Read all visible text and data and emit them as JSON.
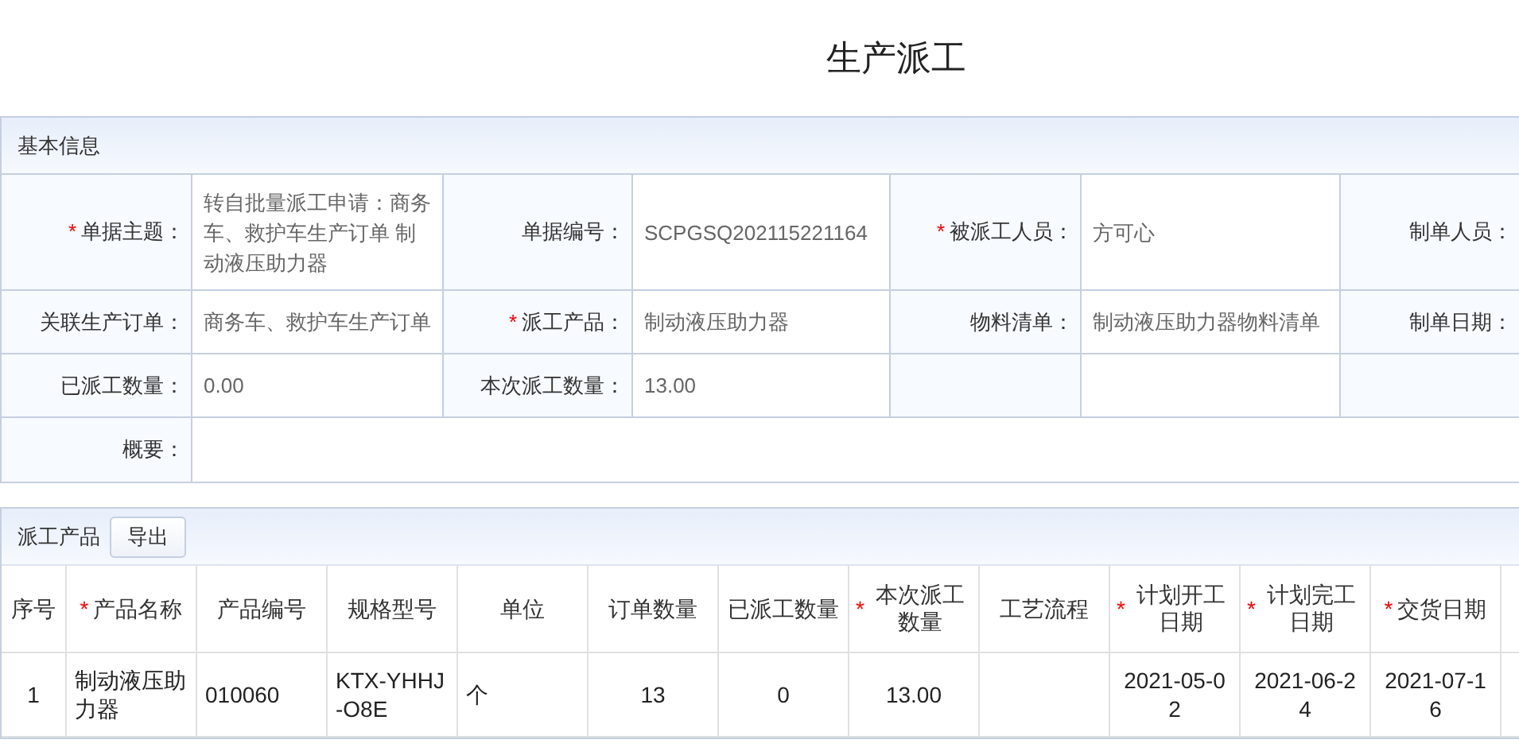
{
  "title": "生产派工",
  "basic_info": {
    "title": "基本信息",
    "rows": [
      [
        {
          "mark": "*",
          "label": "单据主题：",
          "value": "转自批量派工申请：商务车、救护车生产订单 制动液压助力器"
        },
        {
          "label": "单据编号：",
          "value": "SCPGSQ202115221164"
        },
        {
          "mark": "*",
          "label": "被派工人员：",
          "value": "方可心"
        },
        {
          "label": "制单人员："
        }
      ],
      [
        {
          "label": "关联生产订单：",
          "value": "商务车、救护车生产订单"
        },
        {
          "mark": "*",
          "label": "派工产品：",
          "value": "制动液压助力器"
        },
        {
          "label": "物料清单：",
          "value": "制动液压助力器物料清单"
        },
        {
          "label": "制单日期："
        }
      ],
      [
        {
          "label": "已派工数量：",
          "value": "0.00"
        },
        {
          "label": "本次派工数量：",
          "value": "13.00"
        }
      ]
    ],
    "summary_label": "概要："
  },
  "products": {
    "title": "派工产品",
    "export_button": "导出",
    "columns": [
      {
        "label": "序号"
      },
      {
        "mark": "*",
        "label": "产品名称"
      },
      {
        "label": "产品编号"
      },
      {
        "label": "规格型号"
      },
      {
        "label": "单位"
      },
      {
        "label": "订单数量"
      },
      {
        "label": "已派工数量"
      },
      {
        "mark": "*",
        "label": "本次派工数量"
      },
      {
        "label": "工艺流程"
      },
      {
        "mark": "*",
        "label": "计划开工日期"
      },
      {
        "mark": "*",
        "label": "计划完工日期"
      },
      {
        "mark": "*",
        "label": "交货日期"
      }
    ],
    "rows": [
      [
        "1",
        "制动液压助力器",
        "010060",
        "KTX-YHHJ-O8E",
        "个",
        "13",
        "0",
        "13.00",
        "",
        "2021-05-02",
        "2021-06-24",
        "2021-07-16"
      ]
    ]
  }
}
